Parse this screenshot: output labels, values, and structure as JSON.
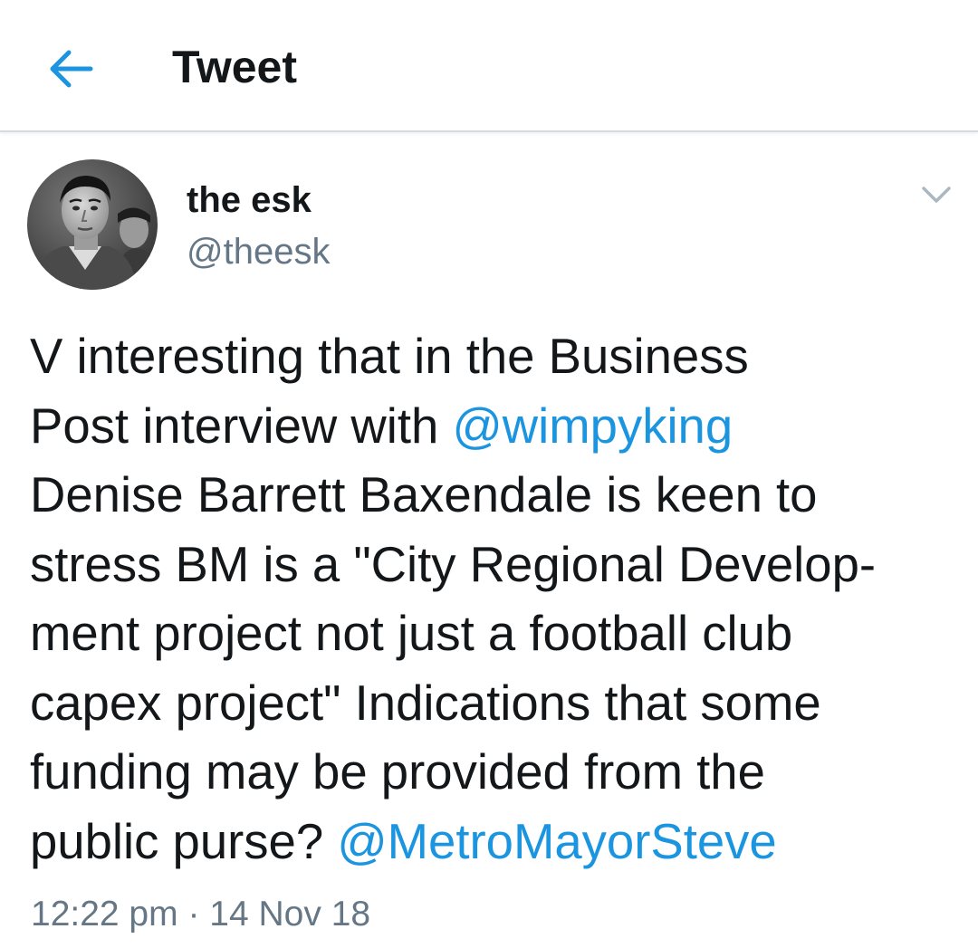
{
  "header": {
    "back_icon": "arrow-left-icon",
    "title": "Tweet"
  },
  "tweet": {
    "author": {
      "display_name": "the esk",
      "handle": "@theesk",
      "avatar": "avatar-photo"
    },
    "menu_icon": "chevron-down-icon",
    "text_lines": [
      [
        {
          "t": "V interesting that in the Business"
        }
      ],
      [
        {
          "t": "Post interview with "
        },
        {
          "t": "@wimpyking",
          "mention": true
        }
      ],
      [
        {
          "t": "Denise Barrett Baxendale is keen to"
        }
      ],
      [
        {
          "t": "stress BM is a \"City Regional Develop-"
        }
      ],
      [
        {
          "t": "ment project not just a football club"
        }
      ],
      [
        {
          "t": "capex project\"  Indications that some"
        }
      ],
      [
        {
          "t": "funding may be provided from the"
        }
      ],
      [
        {
          "t": "public purse? "
        },
        {
          "t": "@MetroMayorSteve",
          "mention": true
        }
      ]
    ],
    "time": "12:22 pm",
    "separator": "·",
    "date": "14 Nov 18"
  },
  "colors": {
    "accent": "#1b95e0",
    "text": "#14171a",
    "secondary": "#657786",
    "divider": "#d6dbdf"
  }
}
